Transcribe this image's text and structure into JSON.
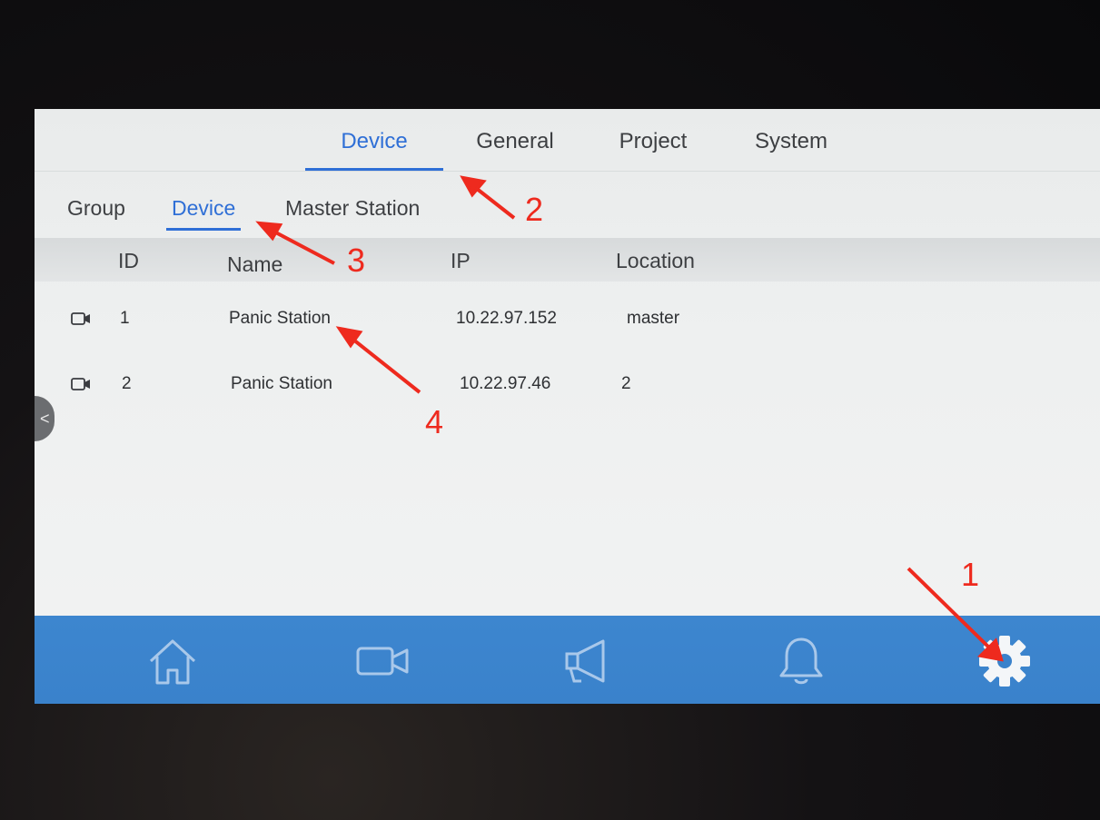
{
  "top_tabs": [
    {
      "label": "Device",
      "active": true
    },
    {
      "label": "General",
      "active": false
    },
    {
      "label": "Project",
      "active": false
    },
    {
      "label": "System",
      "active": false
    }
  ],
  "sub_tabs": [
    {
      "label": "Group",
      "active": false
    },
    {
      "label": "Device",
      "active": true
    },
    {
      "label": "Master Station",
      "active": false
    }
  ],
  "table": {
    "columns": [
      "ID",
      "Name",
      "IP",
      "Location"
    ],
    "rows": [
      {
        "id": "1",
        "name": "Panic Station",
        "ip": "10.22.97.152",
        "location": "master",
        "icon": "camera-icon"
      },
      {
        "id": "2",
        "name": "Panic Station",
        "ip": "10.22.97.46",
        "location": "2",
        "icon": "camera-icon"
      }
    ]
  },
  "side_handle": {
    "glyph": "<"
  },
  "bottom_nav": [
    {
      "icon": "home-icon",
      "active": false
    },
    {
      "icon": "camera-icon",
      "active": false
    },
    {
      "icon": "megaphone-icon",
      "active": false
    },
    {
      "icon": "bell-icon",
      "active": false
    },
    {
      "icon": "gear-icon",
      "active": true
    }
  ],
  "annotations": [
    "1",
    "2",
    "3",
    "4"
  ],
  "colors": {
    "accent": "#2f6fd6",
    "nav_bar": "#3a82cb",
    "annotation": "#ee2a1e"
  }
}
